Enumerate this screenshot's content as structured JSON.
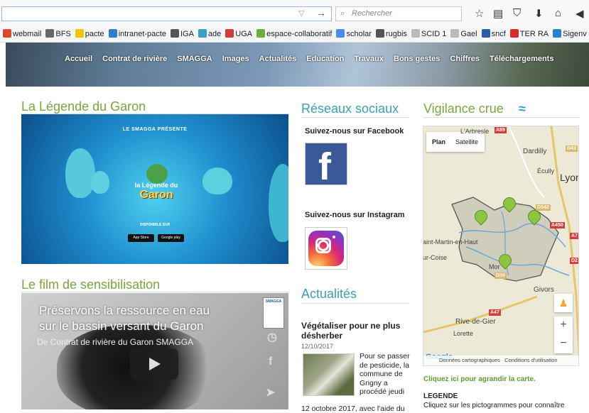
{
  "browser": {
    "search_placeholder": "Rechercher",
    "bookmarks": [
      {
        "label": "webmail",
        "color": "#d94a2e"
      },
      {
        "label": "BFS",
        "color": "#666666"
      },
      {
        "label": "pacte",
        "color": "#f0c400"
      },
      {
        "label": "intranet-pacte",
        "color": "#2a7fd1"
      },
      {
        "label": "IGA",
        "color": "#555555"
      },
      {
        "label": "ade",
        "color": "#3aa0c8"
      },
      {
        "label": "UGA",
        "color": "#d23b3b"
      },
      {
        "label": "espace-collaboratif",
        "color": "#6aaf3a"
      },
      {
        "label": "scholar",
        "color": "#4a8af4"
      },
      {
        "label": "rugbis",
        "color": "#555555"
      },
      {
        "label": "SCID 1",
        "color": "#bbbbbb"
      },
      {
        "label": "Gael",
        "color": "#bbbbbb"
      },
      {
        "label": "sncf",
        "color": "#2e5aa8"
      },
      {
        "label": "TER RA",
        "color": "#d82c2c"
      },
      {
        "label": "Sigenv",
        "color": "#2a7fd1"
      }
    ]
  },
  "nav": [
    "Accueil",
    "Contrat de rivière",
    "SMAGGA",
    "Images",
    "Actualités",
    "Education",
    "Travaux",
    "Bons gestes",
    "Chiffres",
    "Téléchargements"
  ],
  "legende": {
    "title": "La Légende du Garon",
    "lead": "LE SMAGGA PRÉSENTE",
    "logo_line1": "la Légende du",
    "logo_line2": "Garon",
    "available": "DISPONIBLE SUR",
    "store1": "App Store",
    "store2": "Google play"
  },
  "film": {
    "title": "Le film de sensibilisation",
    "line1": "Préservons la ressource en eau",
    "line2": "sur le bassin versant du Garon",
    "subtitle": "De Contrat de rivière du Garon SMAGGA",
    "badge": "SMAGGA"
  },
  "social": {
    "title": "Réseaux sociaux",
    "facebook_label": "Suivez-nous sur Facebook",
    "instagram_label": "Suivez-nous sur Instagram"
  },
  "actualites": {
    "title": "Actualités",
    "article_title": "Végétaliser pour ne plus désherber",
    "date": "12/10/2017",
    "excerpt": "Pour se passer de pesticide, la commune de Grigny a procédé jeudi",
    "excerpt2": "12 octobre 2017, avec l'aide du"
  },
  "vigilance": {
    "title": "Vigilance crue",
    "map_tab_plan": "Plan",
    "map_tab_sat": "Satellite",
    "places": {
      "arbresle": "L'Arbresle",
      "dardilly": "Dardilly",
      "ecully": "Écully",
      "lyon": "Lyon",
      "stmartin": "aint-Martin-en-Haut",
      "coise": "ur-Coise",
      "mornant": "Mor",
      "givors": "Givors",
      "rive": "Rive-de-Gier",
      "lorette": "Lorette"
    },
    "roads": [
      "A89",
      "D43",
      "D342",
      "A450",
      "A47",
      "D30",
      "A7",
      "D2"
    ],
    "attribution_data": "Données cartographiques",
    "attribution_terms": "Conditions d'utilisation",
    "google": "Google",
    "enlarge_link": "Cliquez ici pour agrandir la carte.",
    "legend_head": "LEGENDE",
    "legend_text": "Cliquez sur les pictogrammes pour connaître",
    "gauge_count": 4
  }
}
